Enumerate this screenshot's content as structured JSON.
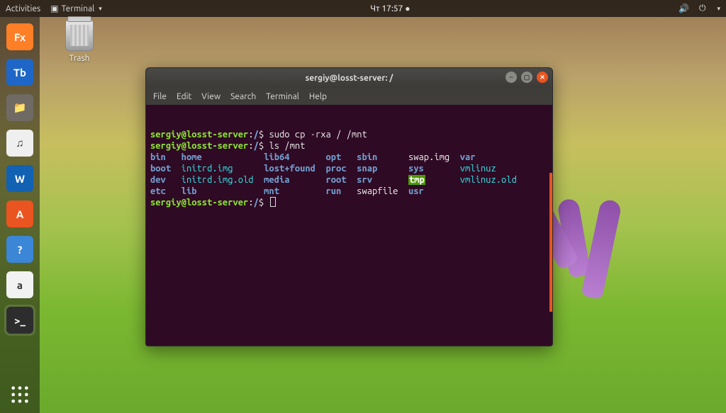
{
  "topbar": {
    "activities": "Activities",
    "app_label": "Terminal",
    "clock": "Чт 17:57",
    "indicators": {
      "volume": "volume-icon",
      "power": "power-icon"
    }
  },
  "desktop": {
    "trash_label": "Trash"
  },
  "dock": {
    "items": [
      {
        "name": "firefox",
        "glyph": "Fx",
        "bgcolor": "#ff7f27"
      },
      {
        "name": "thunderbird",
        "glyph": "Tb",
        "bgcolor": "#1e66c7"
      },
      {
        "name": "files",
        "glyph": "📁",
        "bgcolor": "#6f6a63"
      },
      {
        "name": "rhythmbox",
        "glyph": "♫",
        "bgcolor": "#efefef"
      },
      {
        "name": "writer",
        "glyph": "W",
        "bgcolor": "#1262b3"
      },
      {
        "name": "software",
        "glyph": "A",
        "bgcolor": "#e95420"
      },
      {
        "name": "help",
        "glyph": "?",
        "bgcolor": "#3b86d6"
      },
      {
        "name": "amazon",
        "glyph": "a",
        "bgcolor": "#f2f2f2"
      },
      {
        "name": "terminal",
        "glyph": ">_",
        "bgcolor": "#2d2d2d",
        "active": true
      }
    ],
    "apps_button": "show-applications"
  },
  "terminal": {
    "title": "sergiy@losst-server: /",
    "menu": [
      "File",
      "Edit",
      "View",
      "Search",
      "Terminal",
      "Help"
    ],
    "prompt_user_host": "sergiy@losst-server",
    "prompt_path": "/",
    "prompt_suffix": "$",
    "lines": [
      {
        "type": "cmd",
        "command": "sudo cp -rxa / /mnt"
      },
      {
        "type": "cmd",
        "command": "ls /mnt"
      }
    ],
    "ls_rows": [
      [
        "bin",
        "home",
        "lib64",
        "opt",
        "sbin",
        "swap.img",
        "var"
      ],
      [
        "boot",
        "initrd.img",
        "lost+found",
        "proc",
        "snap",
        "sys",
        "vmlinuz"
      ],
      [
        "dev",
        "initrd.img.old",
        "media",
        "root",
        "srv",
        "tmp",
        "vmlinuz.old"
      ],
      [
        "etc",
        "lib",
        "mnt",
        "run",
        "swapfile",
        "usr",
        ""
      ]
    ],
    "ls_class_rows": [
      [
        "b",
        "b",
        "b",
        "b",
        "b",
        "w",
        "b"
      ],
      [
        "b",
        "c",
        "b",
        "b",
        "b",
        "b",
        "c"
      ],
      [
        "b",
        "c",
        "b",
        "b",
        "b",
        "hl",
        "c"
      ],
      [
        "b",
        "b",
        "b",
        "b",
        "w",
        "b",
        ""
      ]
    ],
    "cursor_prompt": true
  },
  "colors": {
    "accent": "#e95420",
    "term_bg": "#2f0a25",
    "dir": "#729fcf",
    "symlink": "#34e2e2",
    "prompt": "#8ae234"
  }
}
